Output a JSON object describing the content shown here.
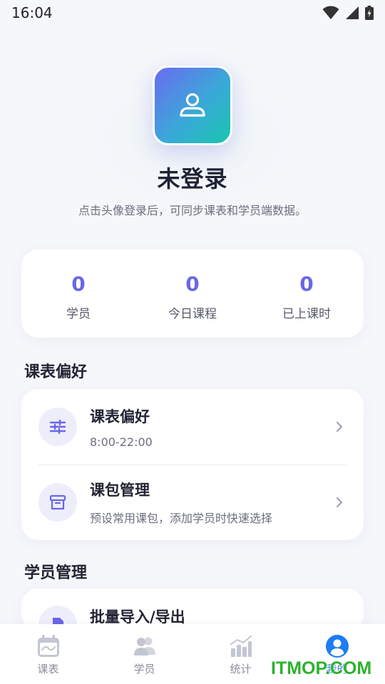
{
  "status_bar": {
    "time": "16:04"
  },
  "profile": {
    "title": "未登录",
    "subtitle": "点击头像登录后，可同步课表和学员端数据。"
  },
  "stats": [
    {
      "value": "0",
      "label": "学员"
    },
    {
      "value": "0",
      "label": "今日课程"
    },
    {
      "value": "0",
      "label": "已上课时"
    }
  ],
  "sections": {
    "schedule": {
      "title": "课表偏好",
      "items": [
        {
          "title": "课表偏好",
          "subtitle": "8:00-22:00",
          "icon": "sliders-icon"
        },
        {
          "title": "课包管理",
          "subtitle": "预设常用课包，添加学员时快速选择",
          "icon": "archive-box-icon"
        }
      ]
    },
    "students": {
      "title": "学员管理",
      "items": [
        {
          "title": "批量导入/导出",
          "icon": "file-icon"
        }
      ]
    }
  },
  "bottom_nav": [
    {
      "label": "课表",
      "icon": "calendar-icon"
    },
    {
      "label": "学员",
      "icon": "users-icon"
    },
    {
      "label": "统计",
      "icon": "bar-chart-icon"
    },
    {
      "label": "我的",
      "icon": "user-circle-icon",
      "active": true
    }
  ],
  "watermark": "ITMOP.COM",
  "colors": {
    "accent": "#6a66e8",
    "active_nav": "#3b7cf0",
    "avatar_gradient_start": "#6a6cf0",
    "avatar_gradient_end": "#19c6ad"
  }
}
